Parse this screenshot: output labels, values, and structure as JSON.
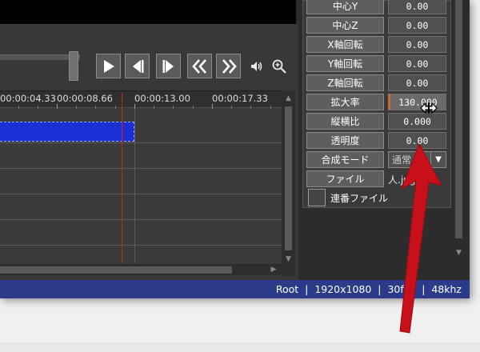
{
  "timeline": {
    "ticks": [
      "00:00:04.33",
      "00:00:08.66",
      "00:00:13.00",
      "00:00:17.33"
    ]
  },
  "properties": {
    "rows": [
      {
        "label": "中心Y",
        "value": "0.00"
      },
      {
        "label": "中心Z",
        "value": "0.00"
      },
      {
        "label": "X軸回転",
        "value": "0.00"
      },
      {
        "label": "Y軸回転",
        "value": "0.00"
      },
      {
        "label": "Z軸回転",
        "value": "0.00"
      },
      {
        "label": "拡大率",
        "value": "130.000"
      },
      {
        "label": "縦横比",
        "value": "0.000"
      },
      {
        "label": "透明度",
        "value": "0.00"
      }
    ],
    "blend_label": "合成モード",
    "blend_value": "通常",
    "file_label": "ファイル",
    "file_value": "人.jpg",
    "sequence_label": "連番ファイル"
  },
  "status": {
    "items": [
      "Root",
      "1920x1080",
      "30fps",
      "48khz"
    ],
    "separator": "|"
  },
  "colors": {
    "statusbar": "#2b3b8a",
    "clip": "#1a2fd4",
    "cursor": "#d02020",
    "arrow": "#c8101a"
  },
  "icons": [
    "play-icon",
    "step-back-icon",
    "step-forward-icon",
    "rewind-icon",
    "fast-forward-icon",
    "volume-icon",
    "zoom-icon",
    "resize-cursor-icon",
    "red-arrow"
  ]
}
